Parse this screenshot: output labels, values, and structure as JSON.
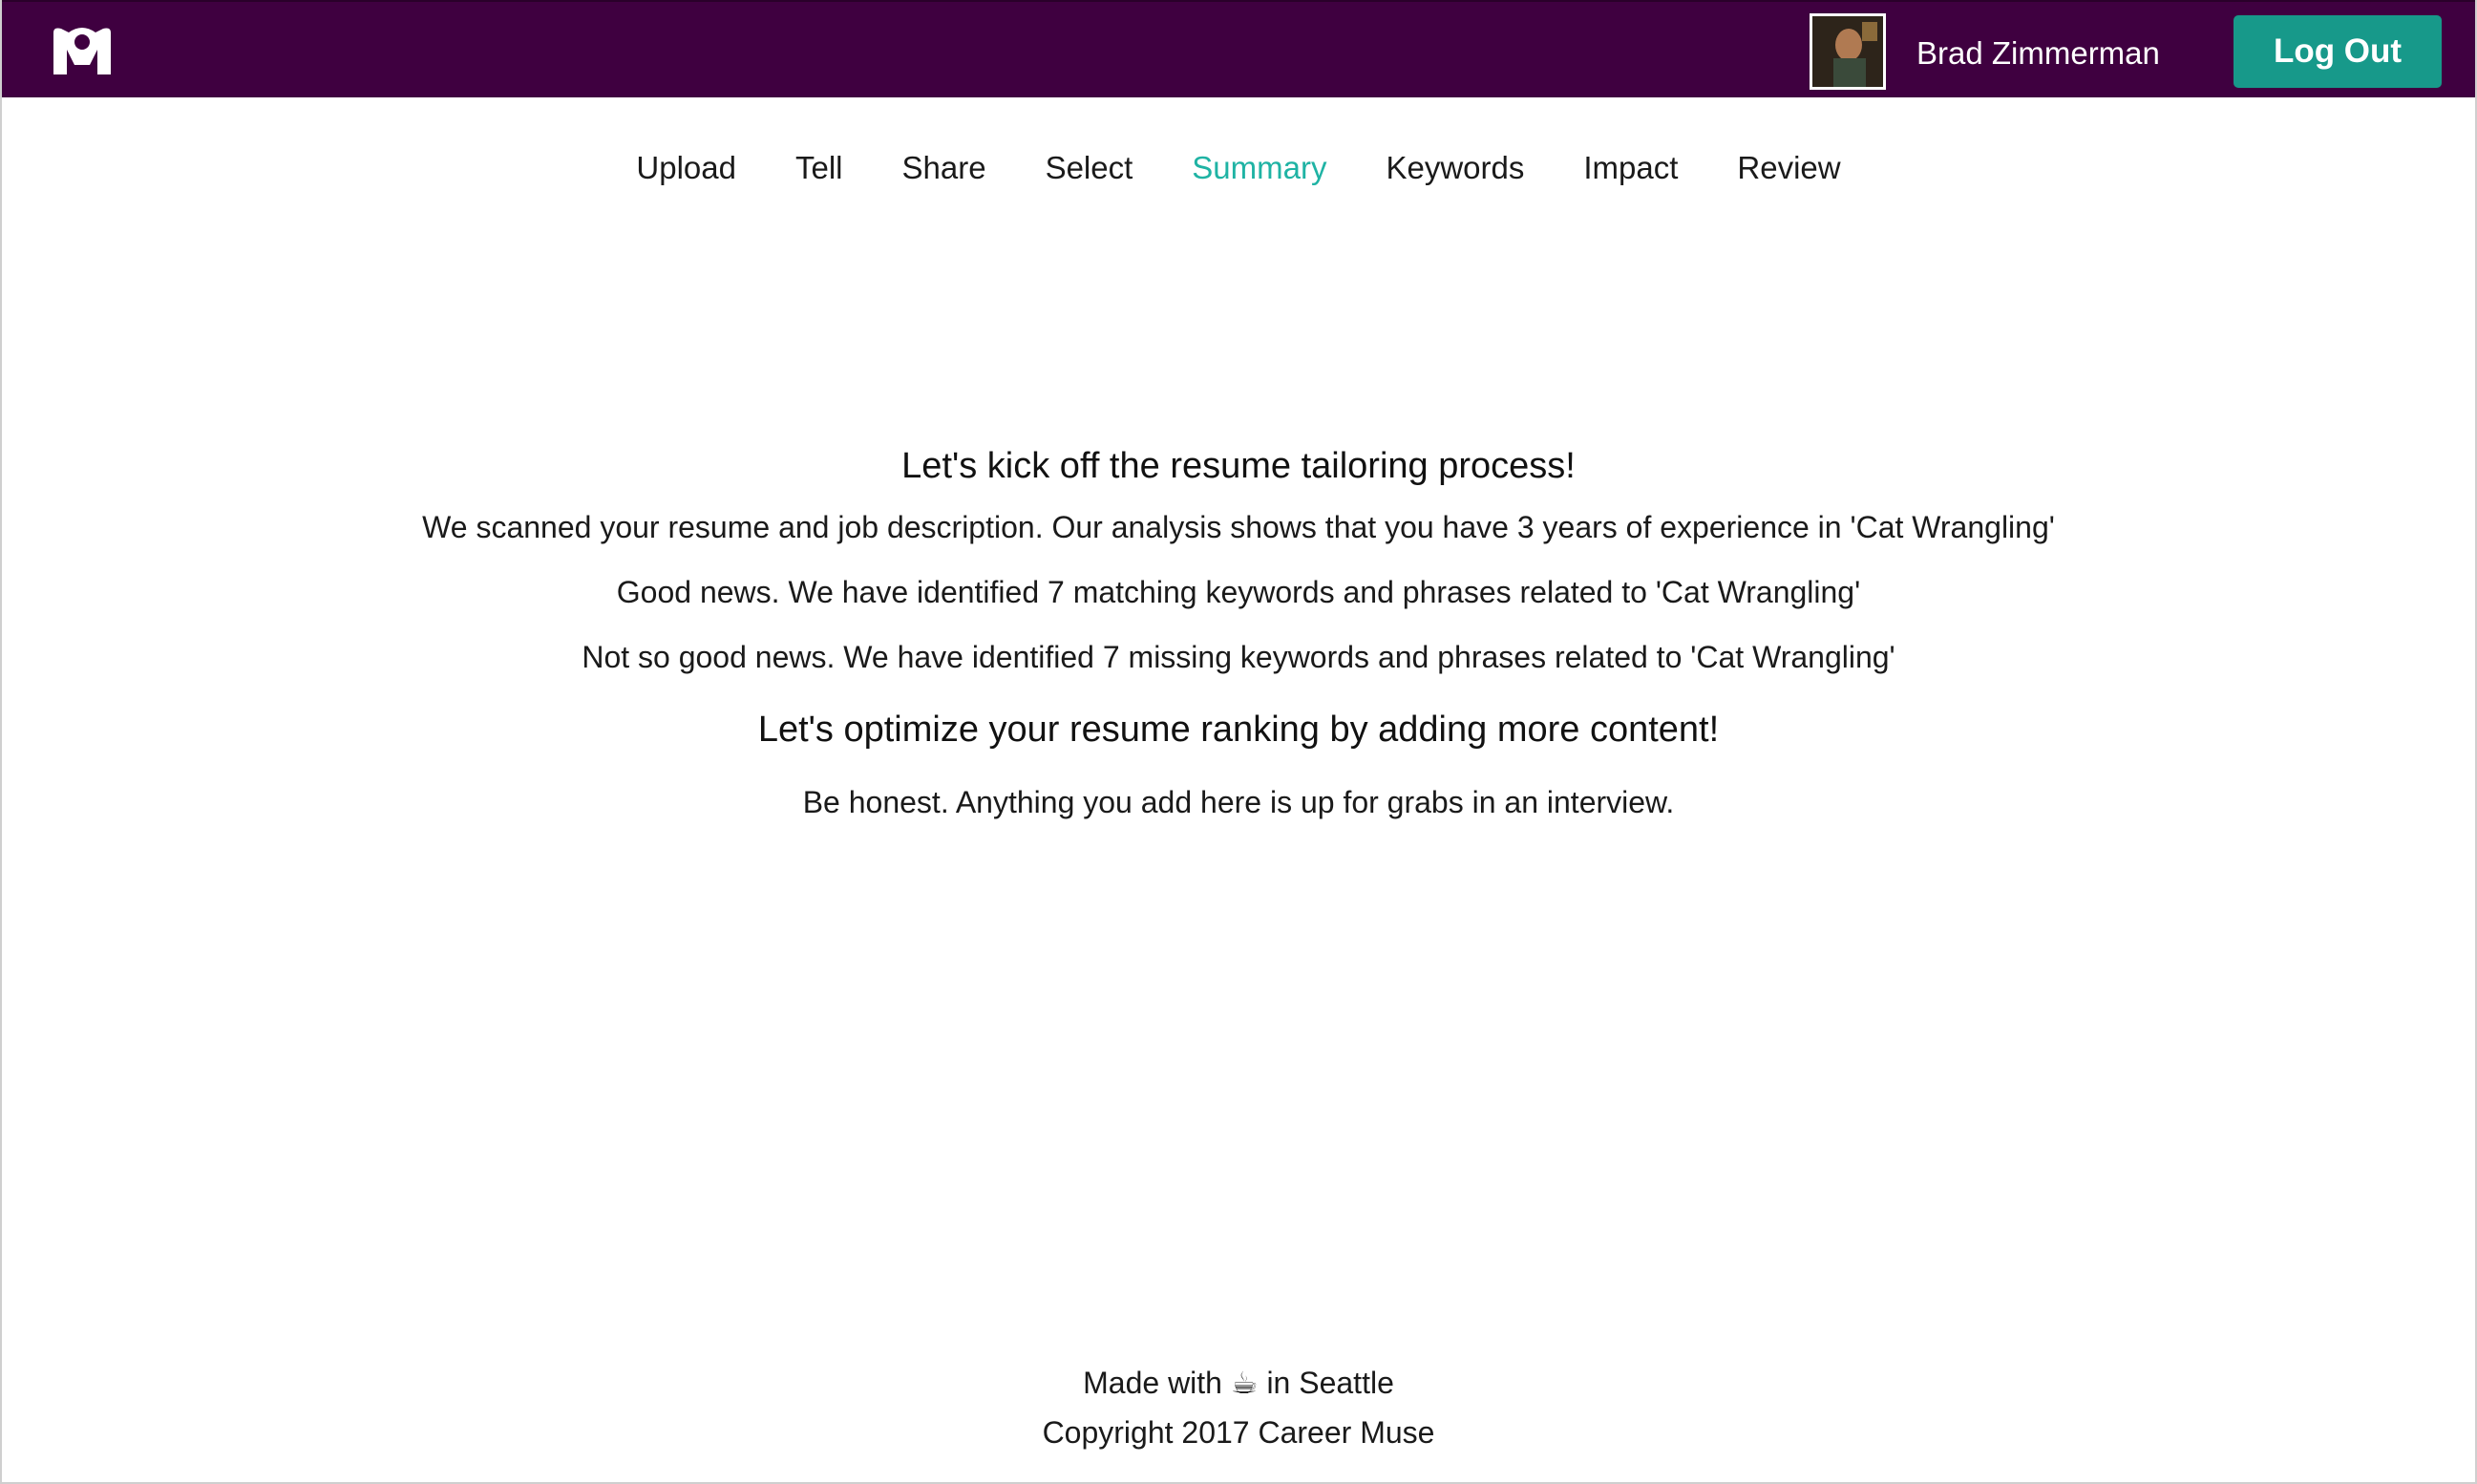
{
  "header": {
    "logo_alt": "M",
    "user_name": "Brad Zimmerman",
    "logout_label": "Log Out",
    "brand_color": "#3f0040",
    "accent_color": "#17998a"
  },
  "nav": {
    "items": [
      {
        "label": "Upload",
        "active": false
      },
      {
        "label": "Tell",
        "active": false
      },
      {
        "label": "Share",
        "active": false
      },
      {
        "label": "Select",
        "active": false
      },
      {
        "label": "Summary",
        "active": true
      },
      {
        "label": "Keywords",
        "active": false
      },
      {
        "label": "Impact",
        "active": false
      },
      {
        "label": "Review",
        "active": false
      }
    ],
    "active_color": "#1fb3a4"
  },
  "main": {
    "heading": "Let's kick off the resume tailoring process!",
    "line_experience": "We scanned your resume and job description. Our analysis shows that you have 3 years of experience in 'Cat Wrangling'",
    "line_good_news": "Good news. We have identified 7 matching keywords and phrases related to 'Cat Wrangling'",
    "line_bad_news": "Not so good news. We have identified 7 missing keywords and phrases related to 'Cat Wrangling'",
    "subheading": "Let's optimize your resume ranking by adding more content!",
    "note": "Be honest. Anything you add here is up for grabs in an interview."
  },
  "footer": {
    "made_with": "Made with ☕ in Seattle",
    "copyright": "Copyright 2017 Career Muse"
  }
}
